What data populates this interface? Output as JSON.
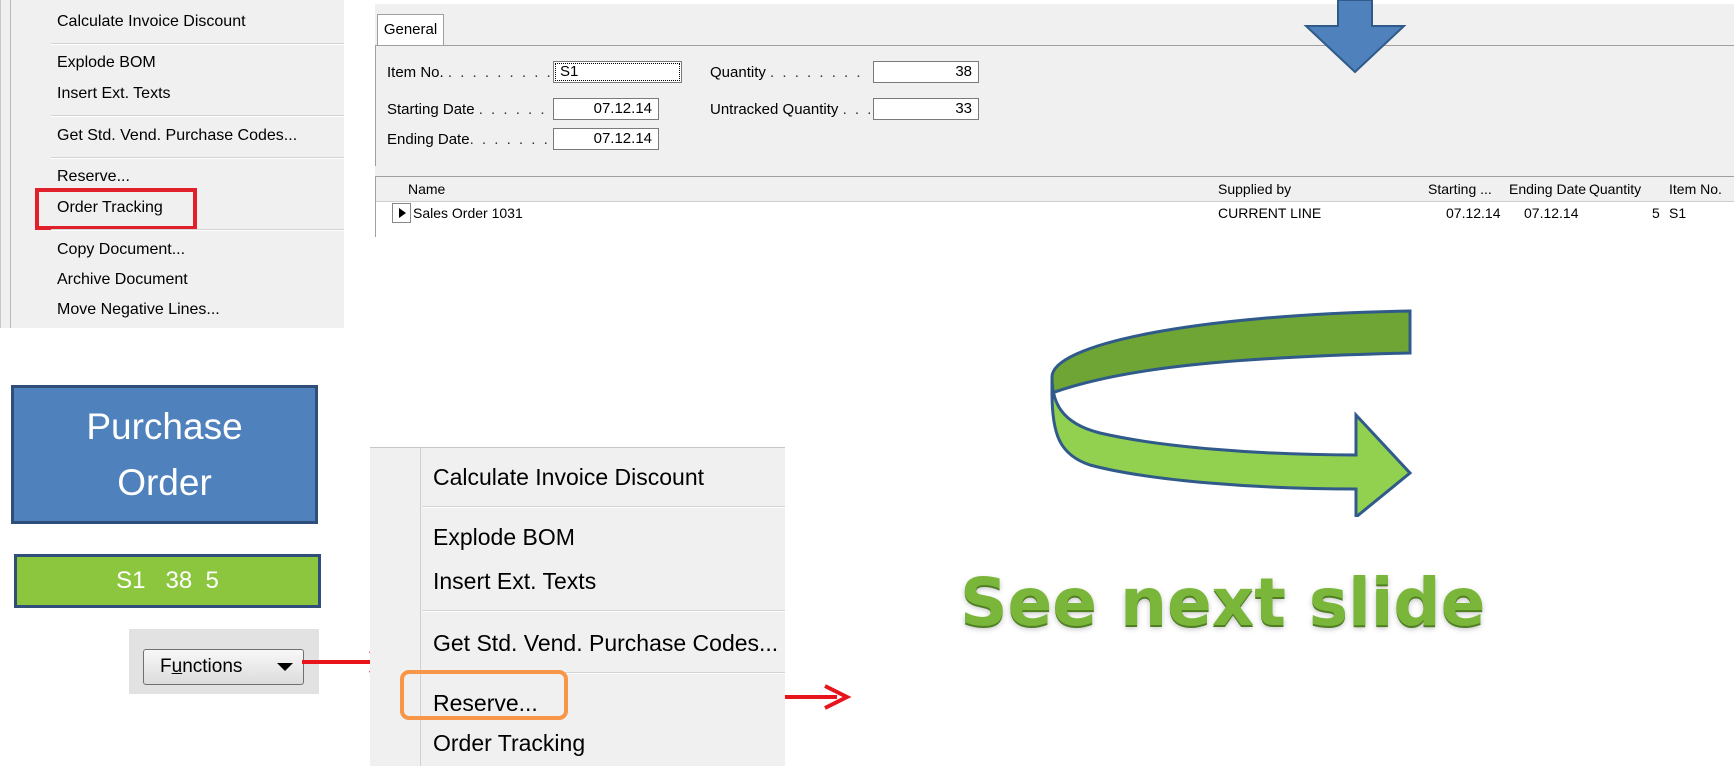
{
  "menu_small": {
    "items": [
      "Calculate Invoice Discount",
      "Explode BOM",
      "Insert Ext. Texts",
      "Get Std. Vend. Purchase Codes...",
      "Reserve...",
      "Order Tracking",
      "Copy Document...",
      "Archive Document",
      "Move Negative Lines..."
    ],
    "highlighted": "Order Tracking",
    "highlight_color": "#e0202a"
  },
  "order_tracking": {
    "tab": "General",
    "fields": {
      "item_no": {
        "label": "Item No.",
        "value": "S1"
      },
      "starting_date": {
        "label": "Starting Date",
        "value": "07.12.14"
      },
      "ending_date": {
        "label": "Ending Date",
        "value": "07.12.14"
      },
      "quantity": {
        "label": "Quantity",
        "value": "38"
      },
      "untracked_quantity": {
        "label": "Untracked Quantity",
        "value": "33"
      }
    },
    "columns": [
      "Name",
      "Supplied by",
      "Starting ...",
      "Ending Date",
      "Quantity",
      "Item No."
    ],
    "rows": [
      {
        "name": "Sales Order 1031",
        "supplied_by": "CURRENT LINE",
        "starting": "07.12.14",
        "ending": "07.12.14",
        "quantity": "5",
        "item_no": "S1"
      }
    ]
  },
  "purchase_order": {
    "title_line1": "Purchase",
    "title_line2": "Order",
    "line_text": "S1   38  5",
    "box_color": "#4f81bd",
    "line_color": "#8cc63f"
  },
  "functions_button": {
    "label_pre": "F",
    "label_underlined": "u",
    "label_post": "nctions"
  },
  "menu_large": {
    "items": [
      "Calculate Invoice Discount",
      "Explode BOM",
      "Insert Ext. Texts",
      "Get Std. Vend. Purchase Codes...",
      "Reserve...",
      "Order Tracking"
    ],
    "highlighted": "Reserve...",
    "highlight_color": "#f79646"
  },
  "headline": {
    "text": "See next slide",
    "color": "#79b63a"
  },
  "arrow_colors": {
    "down_arrow": "#4f81bd",
    "curved_arrow": "#8cc63f",
    "connector_arrows": "#e8141b"
  }
}
